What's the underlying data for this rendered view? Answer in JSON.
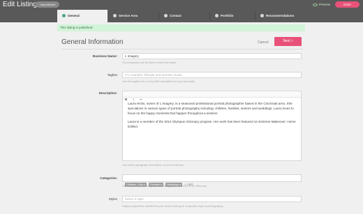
{
  "app": {
    "title": "Edit Listing",
    "status_badge": "Unpublished",
    "preview_label": "Preview",
    "done_label": "Done"
  },
  "tabs": [
    {
      "label": "General",
      "icon": "info-icon",
      "active": true
    },
    {
      "label": "Service Area",
      "icon": "location-pin-icon",
      "active": false
    },
    {
      "label": "Contact",
      "icon": "phone-icon",
      "active": false
    },
    {
      "label": "Portfolio",
      "icon": "image-icon",
      "active": false
    },
    {
      "label": "Recommendations",
      "icon": "chat-icon",
      "active": false
    }
  ],
  "notice": "This listing is published.",
  "section": {
    "title": "General Information",
    "cancel_label": "Cancel",
    "next_label": "Next"
  },
  "form": {
    "business_name": {
      "label": "Business Name:",
      "value": "L Imagery",
      "help": "Your business will be listed under this name"
    },
    "tagline": {
      "label": "Tagline",
      "placeholder": "For example: lifestyle and portraits studio",
      "help": "Use the tagline for a very brief description of your specialty"
    },
    "description": {
      "label": "Description:",
      "toolbar": [
        "B",
        "I",
        "∞"
      ],
      "paragraphs": [
        "Laura Hicks, owner of L Imagery, is a seasoned professional portrait photographer based in the Cincinnati area. She specializes in various types of portrait photography including: children, families, seniors and weddings. Laura loves to focus on the happy moments that happen throughout a session.",
        "Laura is a member of the 2014 Olympus Visionary program. Her work has been featured on Extreme Makeover: Home Edition."
      ],
      "help": "Two-three paragraph description of your business"
    },
    "categories": {
      "label": "Categories:",
      "chips": [
        "Children, Kids",
        "Portraits",
        "Weddings"
      ],
      "add_label": "+ Add",
      "help": "Select up to three categories for listing your business in the directory"
    },
    "styles": {
      "label": "Styles",
      "placeholder": "Select a style",
      "help": "Helps prospective clients find you when looking for a specific style of photography"
    }
  },
  "colors": {
    "topbar": "#595959",
    "accent": "#e8527a",
    "notice_bg": "#d2f4d8",
    "active_tab_icon": "#49a77a"
  }
}
